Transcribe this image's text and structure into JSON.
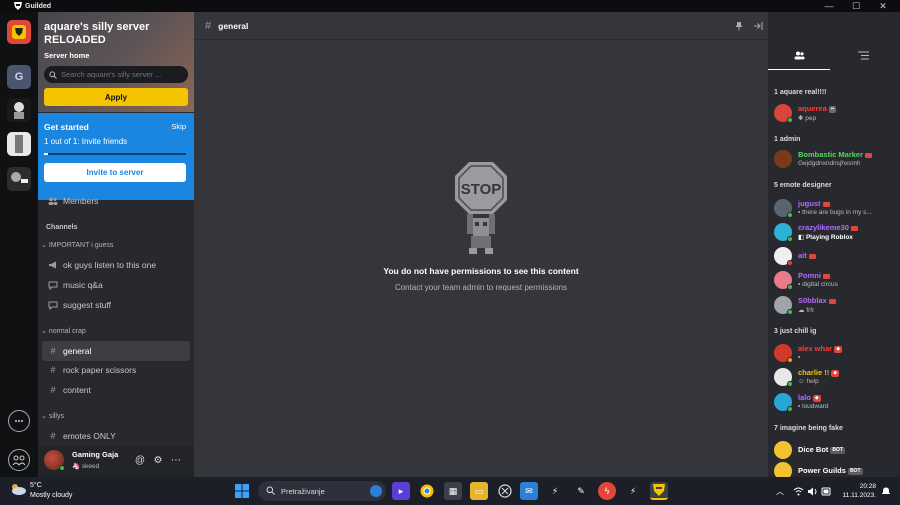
{
  "window": {
    "title": "Guilded"
  },
  "rail": {
    "server_initial": "G"
  },
  "server": {
    "name": "aquare's silly server RELOADED",
    "home_label": "Server home",
    "search_placeholder": "Search aquare's silly server ...",
    "apply_label": "Apply"
  },
  "get_started": {
    "title": "Get started",
    "skip": "Skip",
    "progress_text": "1 out of 1: Invite friends",
    "progress_fraction": 0.03,
    "invite_label": "Invite to server"
  },
  "nav": {
    "members_label": "Members",
    "channels_heading": "Channels",
    "groups": [
      {
        "label": "IMPORTANT i guess",
        "channels": [
          {
            "label": "ok guys listen to this one",
            "icon": "megaphone-icon"
          },
          {
            "label": "music q&a",
            "icon": "speech-bubble-icon"
          },
          {
            "label": "suggest stuff",
            "icon": "speech-bubble-icon"
          }
        ]
      },
      {
        "label": "normal crap",
        "channels": [
          {
            "label": "general",
            "icon": "hash-icon",
            "active": true
          },
          {
            "label": "rock paper scissors",
            "icon": "hash-icon"
          },
          {
            "label": "content",
            "icon": "hash-icon"
          }
        ]
      },
      {
        "label": "sillys",
        "channels": [
          {
            "label": "emotes ONLY",
            "icon": "hash-icon"
          }
        ]
      }
    ]
  },
  "user": {
    "name": "Gaming Gaja",
    "status": "skeed"
  },
  "channel": {
    "name": "general",
    "no_permission_title": "You do not have permissions to see this content",
    "no_permission_sub": "Contact your team admin to request permissions",
    "stop_sign_text": "STOP"
  },
  "members": {
    "groups": [
      {
        "title": "1 aquare real!!!!",
        "members": [
          {
            "name": "aquerea",
            "status": "pep",
            "color": "#ff3b3b",
            "dot": "#3fbe4a",
            "avatar": "#d8453a"
          }
        ]
      },
      {
        "title": "1 admin",
        "members": [
          {
            "name": "Bombastic Marker",
            "status": "Gejdgdnxndnsjhxsmh",
            "color": "#4ddc5a",
            "dot": "#3fbe4a",
            "avatar": "#7a3a18"
          }
        ]
      },
      {
        "title": "5 emote designer",
        "members": [
          {
            "name": "jugust",
            "status": "there are bugs in my s...",
            "color": "#b26bff",
            "dot": "#3fbe4a",
            "avatar": "#5a6470"
          },
          {
            "name": "crazylikeme30",
            "status": "Playing Roblox",
            "color": "#b26bff",
            "dot": "#3fbe4a",
            "avatar": "#2ab3d6"
          },
          {
            "name": "ait",
            "status": "",
            "color": "#b26bff",
            "dot": "#e0473a",
            "avatar": "#f0f0f0"
          },
          {
            "name": "Pomni",
            "status": "digital circus",
            "color": "#b26bff",
            "dot": "#3fbe4a",
            "avatar": "#e87a8a"
          },
          {
            "name": "S0bblax",
            "status": "frfr",
            "color": "#b26bff",
            "dot": "#3fbe4a",
            "avatar": "#a0a4aa"
          }
        ]
      },
      {
        "title": "3 just chill ig",
        "members": [
          {
            "name": "alex whar",
            "status": "",
            "color": "#ff3b3b",
            "dot": "#e0a030",
            "avatar": "#d03a2a"
          },
          {
            "name": "charlie !!",
            "status": "help",
            "color": "#f5c400",
            "dot": "#3fbe4a",
            "avatar": "#e8e8e8"
          },
          {
            "name": "lalo",
            "status": "loudward",
            "color": "#b26bff",
            "dot": "#3fbe4a",
            "avatar": "#2aa6d6"
          }
        ]
      },
      {
        "title": "7 imagine being fake",
        "members": [
          {
            "name": "Dice Bot",
            "status": "",
            "color": "#ffffff",
            "dot": "",
            "avatar": "#f2c230",
            "bot": "BOT"
          },
          {
            "name": "Power Guilds",
            "status": "",
            "color": "#ffffff",
            "dot": "",
            "avatar": "#f2c230",
            "bot": "BOT"
          }
        ]
      }
    ]
  },
  "taskbar": {
    "temperature": "5°C",
    "weather": "Mostly cloudy",
    "search_label": "Pretraživanje",
    "time": "20:28",
    "date": "11.11.2023."
  },
  "colors": {
    "accent_yellow": "#f5c400",
    "get_started_blue": "#1b86e0",
    "sidebar": "#28292e",
    "main": "#35363c"
  }
}
